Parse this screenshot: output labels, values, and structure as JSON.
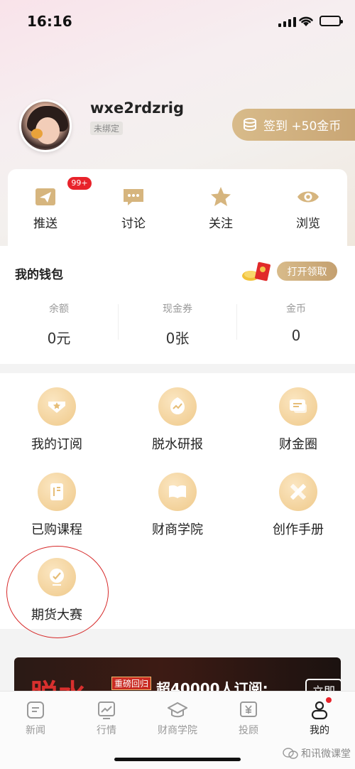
{
  "status": {
    "time": "16:16"
  },
  "profile": {
    "username": "wxe2rdzrig",
    "bind_status": "未绑定",
    "checkin_label": "签到 +50金币"
  },
  "quick": {
    "items": [
      {
        "label": "推送",
        "icon": "paper-plane-icon",
        "badge": "99+"
      },
      {
        "label": "讨论",
        "icon": "chat-bubble-icon"
      },
      {
        "label": "关注",
        "icon": "star-icon"
      },
      {
        "label": "浏览",
        "icon": "eye-icon"
      }
    ]
  },
  "wallet": {
    "title": "我的钱包",
    "open_label": "打开领取",
    "cols": [
      {
        "label": "余额",
        "value": "0元"
      },
      {
        "label": "现金券",
        "value": "0张"
      },
      {
        "label": "金币",
        "value": "0"
      }
    ]
  },
  "grid": {
    "items": [
      {
        "label": "我的订阅",
        "icon": "subscription-icon"
      },
      {
        "label": "脱水研报",
        "icon": "research-report-icon"
      },
      {
        "label": "财金圈",
        "icon": "circle-chat-icon"
      },
      {
        "label": "已购课程",
        "icon": "purchased-course-icon"
      },
      {
        "label": "财商学院",
        "icon": "open-book-icon"
      },
      {
        "label": "创作手册",
        "icon": "pencil-ruler-icon"
      },
      {
        "label": "期货大赛",
        "icon": "futures-contest-icon"
      }
    ]
  },
  "banner": {
    "big_text": "脱水",
    "tag": "重磅回归",
    "sub_text": "超40000人订阅:",
    "button": "立即"
  },
  "tabbar": {
    "items": [
      {
        "label": "新闻",
        "icon": "news-icon"
      },
      {
        "label": "行情",
        "icon": "market-chart-icon"
      },
      {
        "label": "财商学院",
        "icon": "graduation-cap-icon"
      },
      {
        "label": "投顾",
        "icon": "advisor-yen-icon"
      },
      {
        "label": "我的",
        "icon": "profile-icon"
      }
    ]
  },
  "watermark": "和讯微课堂",
  "colors": {
    "gold": "#c9a675",
    "badge_red": "#e8232b",
    "annotation_red": "#d62828"
  }
}
